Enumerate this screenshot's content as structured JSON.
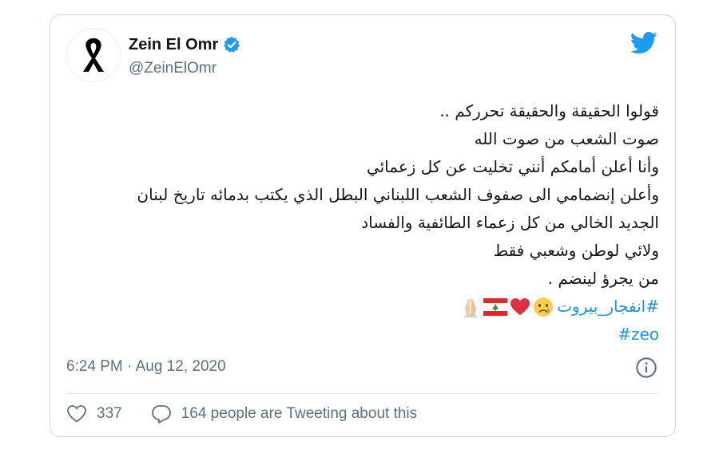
{
  "author": {
    "display_name": "Zein El Omr",
    "handle": "@ZeinElOmr",
    "verified": true,
    "avatar_icon": "black-ribbon-icon"
  },
  "brand": {
    "logo_icon": "twitter-bird-icon",
    "accent_color": "#1b95e0"
  },
  "tweet": {
    "lines": [
      "قولوا الحقيقة والحقيقة تحرركم ..",
      "صوت الشعب من صوت الله",
      "وأنا أعلن أمامكم أنني تخليت عن كل زعمائي",
      "وأعلن إنضمامي الى صفوف الشعب اللبناني البطل الذي يكتب بدمائه تاريخ لبنان",
      "الجديد الخالي من كل زعماء الطائفية والفساد",
      "ولائي لوطن وشعبي فقط",
      "من يجرؤ لينضم ."
    ],
    "hashtag_arabic": "#انفجار_بيروت",
    "emojis": [
      "crying-face-emoji",
      "red-heart-emoji",
      "lebanon-flag-emoji",
      "folded-hands-emoji"
    ],
    "hashtag_latin": "#zeo"
  },
  "meta": {
    "timestamp": "6:24 PM · Aug 12, 2020",
    "info_icon": "info-icon"
  },
  "actions": {
    "like_count": "337",
    "reply_text": "164 people are Tweeting about this"
  }
}
